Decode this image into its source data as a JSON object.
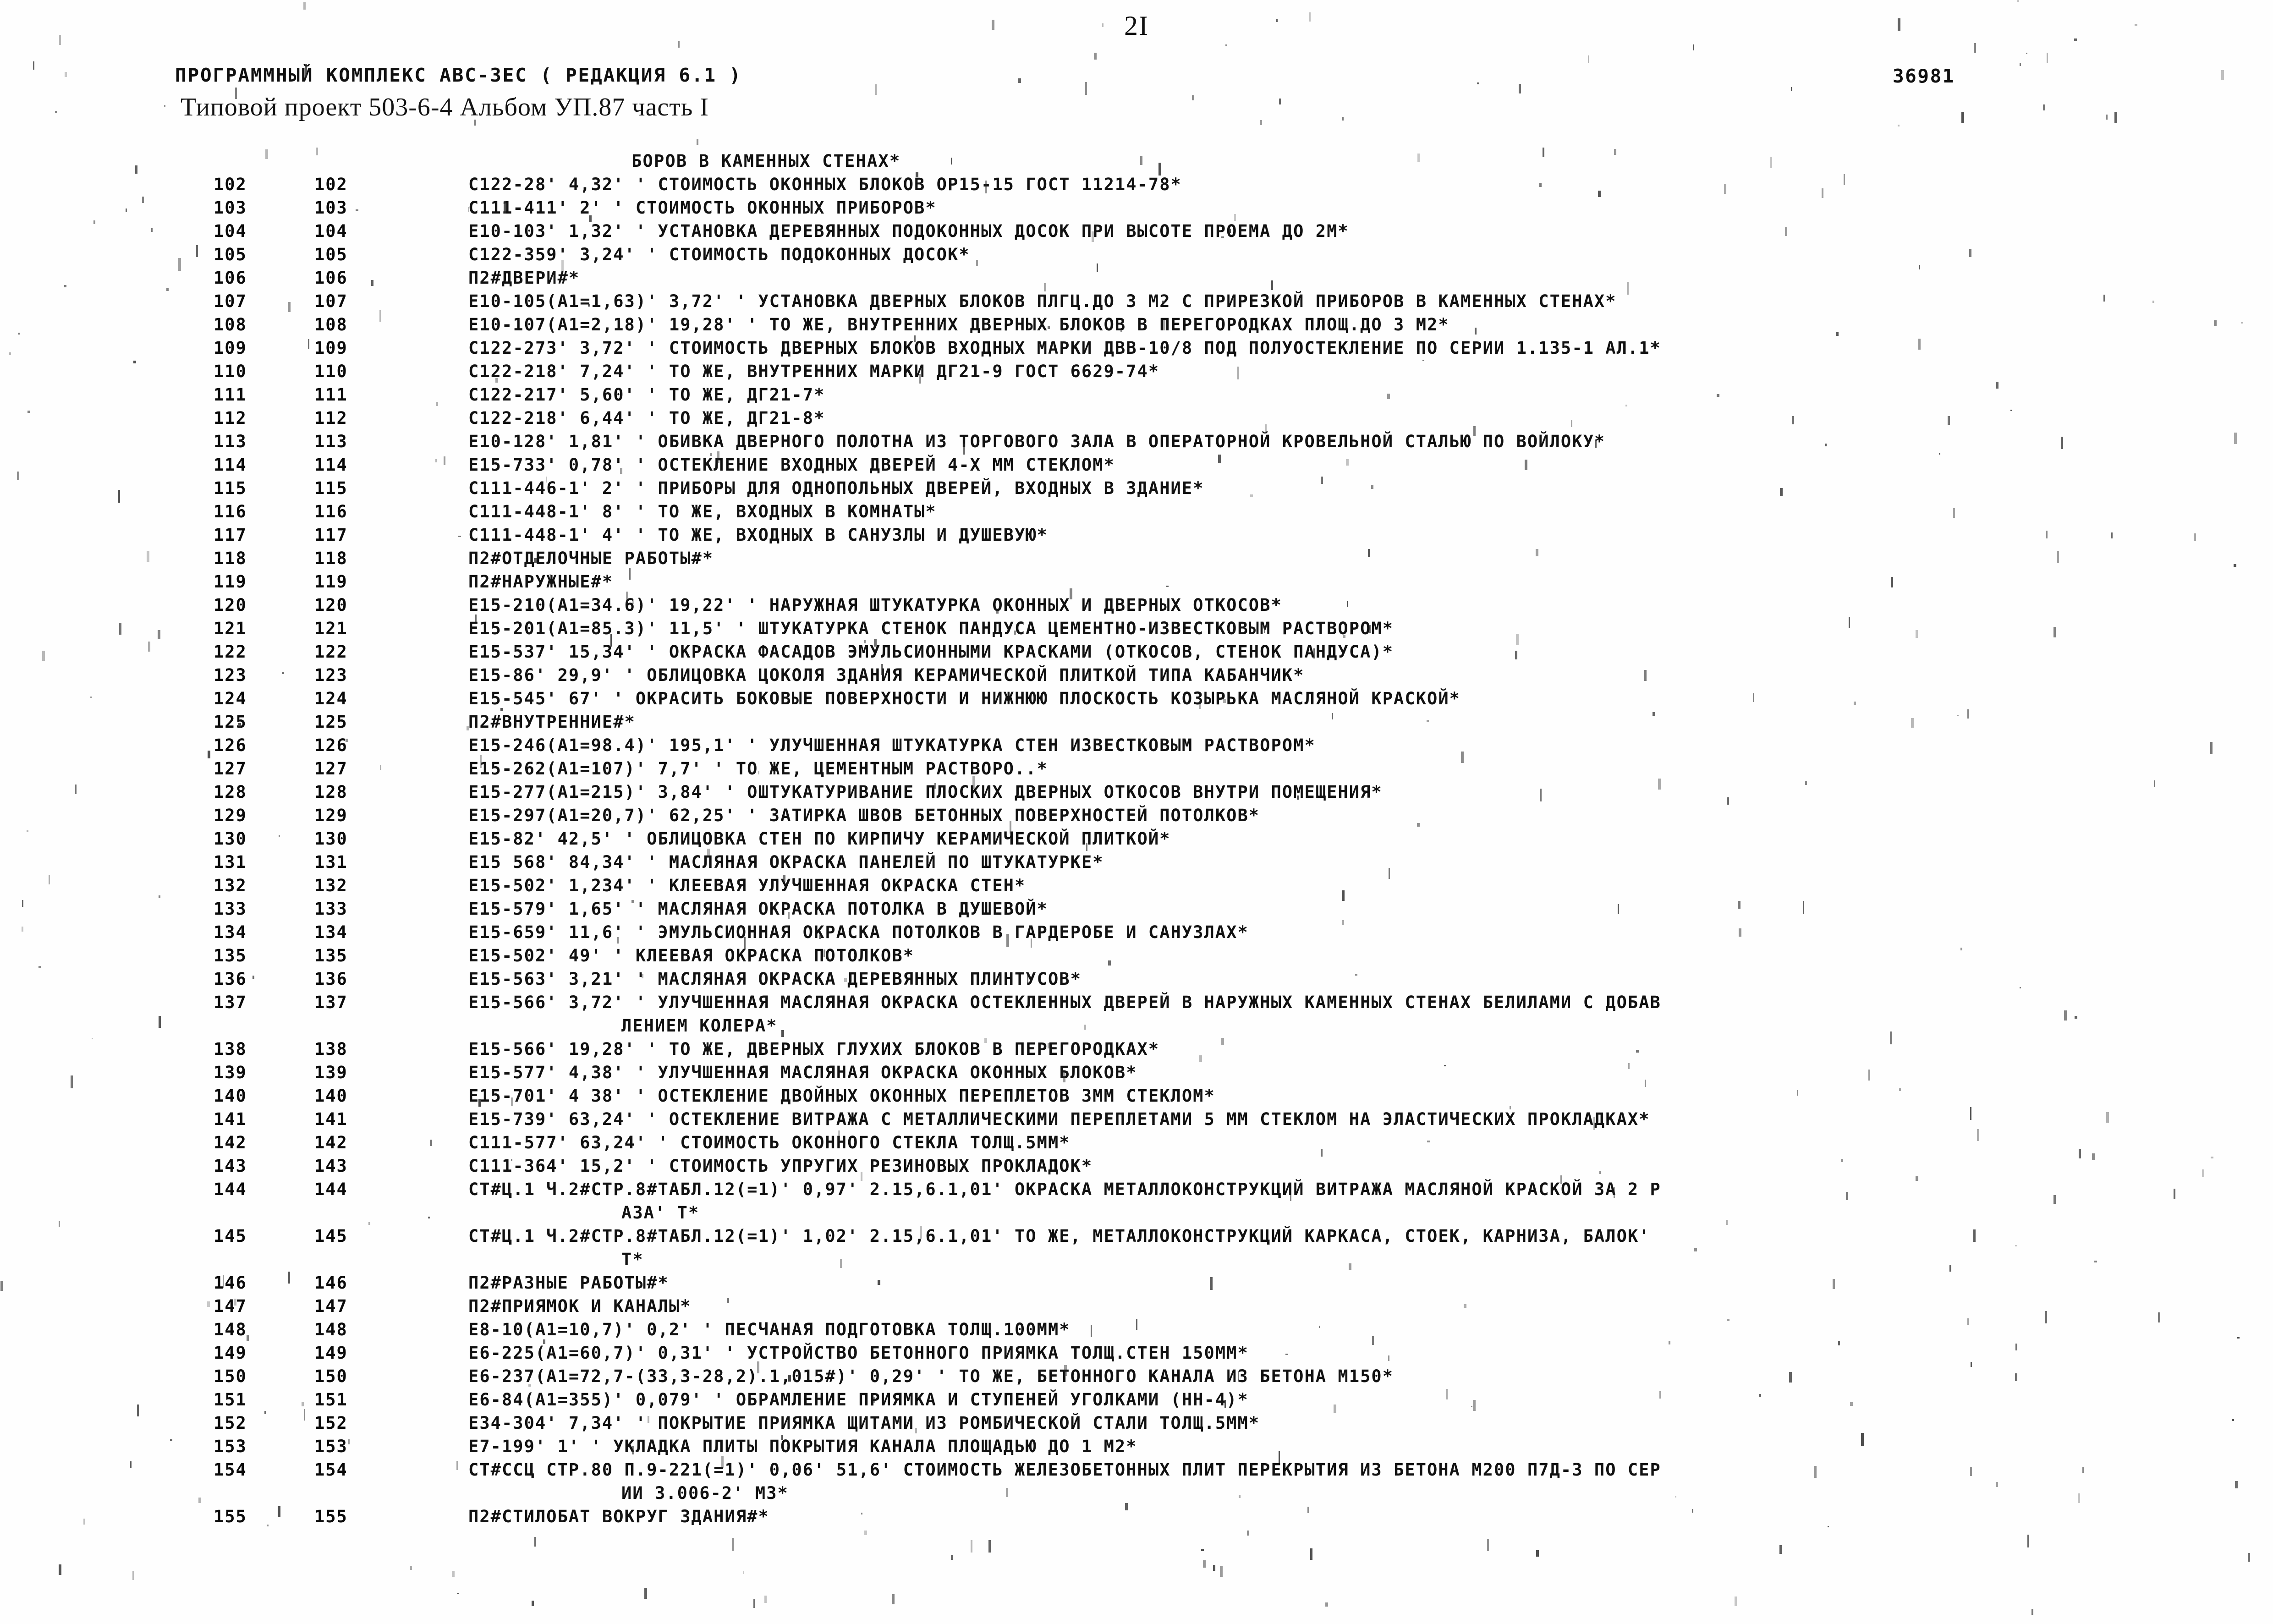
{
  "page": {
    "page_number": "2I",
    "doc_number": "36981"
  },
  "header": {
    "system_line": "ПРОГРАММНЫЙ КОМПЛЕКС АВС-3ЕС   ( РЕДАКЦИЯ  6.1 )",
    "project_line": "Типовой проект 503-6-4   Альбом УП.87   часть I"
  },
  "listing": {
    "section_title": "БОРОВ В КАМЕННЫХ СТЕНАХ*",
    "rows": [
      {
        "num_a": "102",
        "num_b": "102",
        "text": "С122-28' 4,32' ' СТОИМОСТЬ ОКОННЫХ БЛОКОВ ОР15-15 ГОСТ 11214-78*"
      },
      {
        "num_a": "103",
        "num_b": "103",
        "text": "С111-411' 2' ' СТОИМОСТЬ ОКОННЫХ ПРИБОРОВ*"
      },
      {
        "num_a": "104",
        "num_b": "104",
        "text": "Е10-103' 1,32' ' УСТАНОВКА ДЕРЕВЯННЫХ ПОДОКОННЫХ ДОСОК ПРИ ВЫСОТЕ ПРОЕМА ДО 2М*"
      },
      {
        "num_a": "105",
        "num_b": "105",
        "text": "С122-359' 3,24' ' СТОИМОСТЬ ПОДОКОННЫХ ДОСОК*"
      },
      {
        "num_a": "106",
        "num_b": "106",
        "text": "П2#ДВЕРИ#*"
      },
      {
        "num_a": "107",
        "num_b": "107",
        "text": "Е10-105(А1=1,63)' 3,72' ' УСТАНОВКА ДВЕРНЫХ БЛОКОВ ПЛГЦ.ДО 3 М2 С ПРИРЕЗКОЙ ПРИБОРОВ В КАМЕННЫХ СТЕНАХ*"
      },
      {
        "num_a": "108",
        "num_b": "108",
        "text": "Е10-107(А1=2,18)' 19,28' ' ТО ЖЕ, ВНУТРЕННИХ ДВЕРНЫХ БЛОКОВ В ПЕРЕГОРОДКАХ ПЛОЩ.ДО  3 М2*"
      },
      {
        "num_a": "109",
        "num_b": "109",
        "text": "С122-273' 3,72' ' СТОИМОСТЬ ДВЕРНЫХ БЛОКОВ ВХОДНЫХ МАРКИ ДВВ-10/8 ПОД ПОЛУОСТЕКЛЕНИЕ ПО СЕРИИ 1.135-1 АЛ.1*"
      },
      {
        "num_a": "110",
        "num_b": "110",
        "text": "С122-218' 7,24' ' ТО ЖЕ, ВНУТРЕННИХ МАРКИ ДГ21-9 ГОСТ 6629-74*"
      },
      {
        "num_a": "111",
        "num_b": "111",
        "text": "С122-217' 5,60' ' ТО ЖЕ, ДГ21-7*"
      },
      {
        "num_a": "112",
        "num_b": "112",
        "text": "С122-218' 6,44' ' ТО ЖЕ, ДГ21-8*"
      },
      {
        "num_a": "113",
        "num_b": "113",
        "text": "Е10-128' 1,81' ' ОБИВКА ДВЕРНОГО ПОЛОТНА ИЗ ТОРГОВОГО ЗАЛА В ОПЕРАТОРНОЙ КРОВЕЛЬНОЙ СТАЛЬЮ ПО ВОЙЛОКУ*"
      },
      {
        "num_a": "114",
        "num_b": "114",
        "text": "Е15-733' 0,78' ' ОСТЕКЛЕНИЕ ВХОДНЫХ ДВЕРЕЙ 4-Х ММ СТЕКЛОМ*"
      },
      {
        "num_a": "115",
        "num_b": "115",
        "text": "С111-446-1' 2' ' ПРИБОРЫ ДЛЯ ОДНОПОЛЬНЫХ ДВЕРЕЙ, ВХОДНЫХ В ЗДАНИЕ*"
      },
      {
        "num_a": "116",
        "num_b": "116",
        "text": "С111-448-1' 8' ' ТО ЖЕ, ВХОДНЫХ В КОМНАТЫ*"
      },
      {
        "num_a": "117",
        "num_b": "117",
        "text": "С111-448-1' 4' ' ТО ЖЕ, ВХОДНЫХ В САНУЗЛЫ И ДУШЕВУЮ*"
      },
      {
        "num_a": "118",
        "num_b": "118",
        "text": "П2#ОТДЕЛОЧНЫЕ РАБОТЫ#*"
      },
      {
        "num_a": "119",
        "num_b": "119",
        "text": "П2#НАРУЖНЫЕ#*"
      },
      {
        "num_a": "120",
        "num_b": "120",
        "text": "Е15-210(А1=34.6)' 19,22' ' НАРУЖНАЯ ШТУКАТУРКА ОКОННЫХ И ДВЕРНЫХ ОТКОСОВ*"
      },
      {
        "num_a": "121",
        "num_b": "121",
        "text": "Е15-201(А1=85.3)' 11,5' ' ШТУКАТУРКА СТЕНОК ПАНДУСА ЦЕМЕНТНО-ИЗВЕСТКОВЫМ РАСТВОРОМ*"
      },
      {
        "num_a": "122",
        "num_b": "122",
        "text": "Е15-537' 15,34' ' ОКРАСКА ФАСАДОВ ЭМУЛЬСИОННЫМИ КРАСКАМИ (ОТКОСОВ, СТЕНОК ПАНДУСА)*"
      },
      {
        "num_a": "123",
        "num_b": "123",
        "text": "Е15-86' 29,9' ' ОБЛИЦОВКА ЦОКОЛЯ ЗДАНИЯ КЕРАМИЧЕСКОЙ ПЛИТКОЙ ТИПА КАБАНЧИК*"
      },
      {
        "num_a": "124",
        "num_b": "124",
        "text": "Е15-545' 67' ' ОКРАСИТЬ БОКОВЫЕ ПОВЕРХНОСТИ И НИЖНЮЮ ПЛОСКОСТЬ КОЗЫРЬКА МАСЛЯНОЙ КРАСКОЙ*"
      },
      {
        "num_a": "125",
        "num_b": "125",
        "text": "П2#ВНУТРЕННИЕ#*"
      },
      {
        "num_a": "126",
        "num_b": "126",
        "text": "Е15-246(А1=98.4)' 195,1' ' УЛУЧШЕННАЯ ШТУКАТУРКА СТЕН ИЗВЕСТКОВЫМ РАСТВОРОМ*"
      },
      {
        "num_a": "127",
        "num_b": "127",
        "text": "Е15-262(А1=107)' 7,7' ' ТО ЖЕ, ЦЕМЕНТНЫМ РАСТВОРО..*"
      },
      {
        "num_a": "128",
        "num_b": "128",
        "text": "Е15-277(А1=215)' 3,84' ' ОШТУКАТУРИВАНИЕ ПЛОСКИХ ДВЕРНЫХ ОТКОСОВ ВНУТРИ ПОМЕЩЕНИЯ*"
      },
      {
        "num_a": "129",
        "num_b": "129",
        "text": "Е15-297(А1=20,7)' 62,25' ' ЗАТИРКА ШВОВ БЕТОННЫХ ПОВЕРХНОСТЕЙ ПОТОЛКОВ*"
      },
      {
        "num_a": "130",
        "num_b": "130",
        "text": "Е15-82' 42,5' ' ОБЛИЦОВКА СТЕН ПО КИРПИЧУ КЕРАМИЧЕСКОЙ ПЛИТКОЙ*"
      },
      {
        "num_a": "131",
        "num_b": "131",
        "text": "Е15 568' 84,34' ' МАСЛЯНАЯ ОКРАСКА ПАНЕЛЕЙ ПО ШТУКАТУРКЕ*"
      },
      {
        "num_a": "132",
        "num_b": "132",
        "text": "Е15-502' 1,234' ' КЛЕЕВАЯ УЛУЧШЕННАЯ ОКРАСКА СТЕН*"
      },
      {
        "num_a": "133",
        "num_b": "133",
        "text": "Е15-579' 1,65' ' МАСЛЯНАЯ ОКРАСКА ПОТОЛКА В ДУШЕВОЙ*"
      },
      {
        "num_a": "134",
        "num_b": "134",
        "text": "Е15-659' 11,6' ' ЭМУЛЬСИОННАЯ ОКРАСКА ПОТОЛКОВ В ГАРДЕРОБЕ И САНУЗЛАХ*"
      },
      {
        "num_a": "135",
        "num_b": "135",
        "text": "Е15-502' 49' ' КЛЕЕВАЯ ОКРАСКА ПОТОЛКОВ*"
      },
      {
        "num_a": "136",
        "num_b": "136",
        "text": "Е15-563' 3,21' ' МАСЛЯНАЯ ОКРАСКА ДЕРЕВЯННЫХ ПЛИНТУСОВ*"
      },
      {
        "num_a": "137",
        "num_b": "137",
        "text": "Е15-566' 3,72' ' УЛУЧШЕННАЯ МАСЛЯНАЯ ОКРАСКА ОСТЕКЛЕННЫХ ДВЕРЕЙ В НАРУЖНЫХ КАМЕННЫХ СТЕНАХ БЕЛИЛАМИ С ДОБАВ"
      },
      {
        "num_a": "",
        "num_b": "",
        "text": "ЛЕНИЕМ КОЛЕРА*",
        "continuation": true
      },
      {
        "num_a": "138",
        "num_b": "138",
        "text": "Е15-566' 19,28' ' ТО ЖЕ, ДВЕРНЫХ ГЛУХИХ БЛОКОВ В ПЕРЕГОРОДКАХ*"
      },
      {
        "num_a": "139",
        "num_b": "139",
        "text": "Е15-577' 4,38' ' УЛУЧШЕННАЯ МАСЛЯНАЯ ОКРАСКА ОКОННЫХ БЛОКОВ*"
      },
      {
        "num_a": "140",
        "num_b": "140",
        "text": "Е15-701' 4 38' ' ОСТЕКЛЕНИЕ ДВОЙНЫХ ОКОННЫХ ПЕРЕПЛЕТОВ 3ММ СТЕКЛОМ*"
      },
      {
        "num_a": "141",
        "num_b": "141",
        "text": "Е15-739' 63,24' ' ОСТЕКЛЕНИЕ ВИТРАЖА С МЕТАЛЛИЧЕСКИМИ ПЕРЕПЛЕТАМИ 5 ММ СТЕКЛОМ НА ЭЛАСТИЧЕСКИХ ПРОКЛАДКАХ*"
      },
      {
        "num_a": "142",
        "num_b": "142",
        "text": "С111-577' 63,24' ' СТОИМОСТЬ ОКОННОГО СТЕКЛА ТОЛЩ.5ММ*"
      },
      {
        "num_a": "143",
        "num_b": "143",
        "text": "С111-364' 15,2' ' СТОИМОСТЬ УПРУГИХ РЕЗИНОВЫХ ПРОКЛАДОК*"
      },
      {
        "num_a": "144",
        "num_b": "144",
        "text": "СТ#Ц.1 Ч.2#СТР.8#ТАБЛ.12(=1)' 0,97' 2.15,6.1,01' ОКРАСКА МЕТАЛЛОКОНСТРУКЦИЙ ВИТРАЖА МАСЛЯНОЙ КРАСКОЙ ЗА 2 Р"
      },
      {
        "num_a": "",
        "num_b": "",
        "text": "АЗА' Т*",
        "continuation": true
      },
      {
        "num_a": "145",
        "num_b": "145",
        "text": "СТ#Ц.1 Ч.2#СТР.8#ТАБЛ.12(=1)' 1,02' 2.15,6.1,01' ТО ЖЕ, МЕТАЛЛОКОНСТРУКЦИЙ КАРКАСА, СТОЕК, КАРНИЗА, БАЛОК'"
      },
      {
        "num_a": "",
        "num_b": "",
        "text": "Т*",
        "continuation": true
      },
      {
        "num_a": "146",
        "num_b": "146",
        "text": "П2#РАЗНЫЕ РАБОТЫ#*"
      },
      {
        "num_a": "147",
        "num_b": "147",
        "text": "П2#ПРИЯМОК И КАНАЛЫ*"
      },
      {
        "num_a": "148",
        "num_b": "148",
        "text": "Е8-10(А1=10,7)' 0,2' ' ПЕСЧАНАЯ ПОДГОТОВКА ТОЛЩ.100ММ*"
      },
      {
        "num_a": "149",
        "num_b": "149",
        "text": "Е6-225(А1=60,7)' 0,31' ' УСТРОЙСТВО БЕТОННОГО ПРИЯМКА ТОЛЩ.СТЕН 150ММ*"
      },
      {
        "num_a": "150",
        "num_b": "150",
        "text": "Е6-237(А1=72,7-(33,3-28,2).1,015#)' 0,29' ' ТО ЖЕ, БЕТОННОГО КАНАЛА ИЗ БЕТОНА М150*"
      },
      {
        "num_a": "151",
        "num_b": "151",
        "text": "Е6-84(А1=355)' 0,079' ' ОБРАМЛЕНИЕ ПРИЯМКА И СТУПЕНЕЙ УГОЛКАМИ (НН-4)*"
      },
      {
        "num_a": "152",
        "num_b": "152",
        "text": "Е34-304' 7,34' ' ПОКРЫТИЕ ПРИЯМКА ЩИТАМИ ИЗ РОМБИЧЕСКОЙ СТАЛИ ТОЛЩ.5ММ*"
      },
      {
        "num_a": "153",
        "num_b": "153",
        "text": "Е7-199' 1' ' УКЛАДКА ПЛИТЫ ПОКРЫТИЯ КАНАЛА ПЛОЩАДЬЮ ДО 1 М2*"
      },
      {
        "num_a": "154",
        "num_b": "154",
        "text": "СТ#ССЦ СТР.80 П.9-221(=1)' 0,06' 51,6' СТОИМОСТЬ ЖЕЛЕЗОБЕТОННЫХ ПЛИТ ПЕРЕКРЫТИЯ ИЗ БЕТОНА М200 П7Д-3 ПО СЕР"
      },
      {
        "num_a": "",
        "num_b": "",
        "text": "ИИ 3.006-2' М3*",
        "continuation": true
      },
      {
        "num_a": "155",
        "num_b": "155",
        "text": "П2#СТИЛОБАТ ВОКРУГ ЗДАНИЯ#*"
      }
    ]
  }
}
